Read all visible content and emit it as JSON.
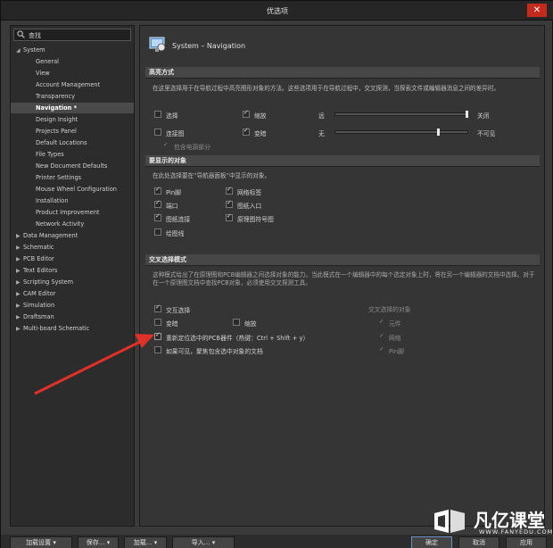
{
  "window": {
    "title": "优选项",
    "close": "✕"
  },
  "search": {
    "value": "查找"
  },
  "tree": [
    {
      "label": "System",
      "arrow": "◢",
      "depth": 0
    },
    {
      "label": "General",
      "arrow": "",
      "depth": 1
    },
    {
      "label": "View",
      "arrow": "",
      "depth": 1
    },
    {
      "label": "Account Management",
      "arrow": "",
      "depth": 1
    },
    {
      "label": "Transparency",
      "arrow": "",
      "depth": 1
    },
    {
      "label": "Navigation *",
      "arrow": "",
      "depth": 1,
      "selected": true
    },
    {
      "label": "Design Insight",
      "arrow": "",
      "depth": 1
    },
    {
      "label": "Projects Panel",
      "arrow": "",
      "depth": 1
    },
    {
      "label": "Default Locations",
      "arrow": "",
      "depth": 1
    },
    {
      "label": "File Types",
      "arrow": "",
      "depth": 1
    },
    {
      "label": "New Document Defaults",
      "arrow": "",
      "depth": 1
    },
    {
      "label": "Printer Settings",
      "arrow": "",
      "depth": 1
    },
    {
      "label": "Mouse Wheel Configuration",
      "arrow": "",
      "depth": 1
    },
    {
      "label": "Installation",
      "arrow": "",
      "depth": 1
    },
    {
      "label": "Product Improvement",
      "arrow": "",
      "depth": 1
    },
    {
      "label": "Network Activity",
      "arrow": "",
      "depth": 1
    },
    {
      "label": "Data Management",
      "arrow": "▶",
      "depth": 0
    },
    {
      "label": "Schematic",
      "arrow": "▶",
      "depth": 0
    },
    {
      "label": "PCB Editor",
      "arrow": "▶",
      "depth": 0
    },
    {
      "label": "Text Editors",
      "arrow": "▶",
      "depth": 0
    },
    {
      "label": "Scripting System",
      "arrow": "▶",
      "depth": 0
    },
    {
      "label": "CAM Editor",
      "arrow": "▶",
      "depth": 0
    },
    {
      "label": "Simulation",
      "arrow": "▶",
      "depth": 0
    },
    {
      "label": "Draftsman",
      "arrow": "▶",
      "depth": 0
    },
    {
      "label": "Multi-board Schematic",
      "arrow": "▶",
      "depth": 0
    }
  ],
  "page": {
    "title": "System – Navigation"
  },
  "highlight": {
    "header": "高亮方式",
    "desc": "在这里选择用于在导航过程中高亮图形对象的方法。这些选项用于在导航过程中，交叉探测，当探索文件或编辑器消息之间的差异时。",
    "select": "选择",
    "zoom": "缩放",
    "far": "远",
    "off": "关闭",
    "connect": "连接图",
    "dim": "变暗",
    "none": "无",
    "invisible": "不可见",
    "power": "包含电源部分",
    "slider1_level": 1.0,
    "slider2_level": 0.78
  },
  "display": {
    "header": "要显示的对象",
    "desc": "在此处选择要在“导航器面板”中显示的对象。",
    "pin": "Pin脚",
    "netlabel": "网络标签",
    "port": "端口",
    "sheetentry": "图纸入口",
    "sheetconn": "图纸连接",
    "sheetsym": "原理图符号图",
    "wire": "绘图线"
  },
  "cross": {
    "header": "交叉选择模式",
    "desc": "这种模式给出了在原理图和PCB编辑器之间选择对象的能力。当此模式在一个编辑器中的每个选定对象上时，将在另一个编辑器的文档中选择。对于在一个原理图文档中查找PCB对象，必须使用交叉探测工具。",
    "enable": "交互选择",
    "dim": "变暗",
    "zoom": "缩放",
    "reposition": "重新定位选中的PCB器件（热键：Ctrl + Shift + y）",
    "focus": "如果可见，聚焦包含选中对象的文档",
    "objects_header": "交叉选择的对象",
    "obj_part": "元件",
    "obj_net": "网络",
    "obj_pin": "Pin脚"
  },
  "buttons": {
    "save": "加载设置",
    "save2": "保存...",
    "load": "加载...",
    "import": "导入...",
    "ok": "确定",
    "cancel": "取消",
    "apply": "应用"
  },
  "watermark": {
    "brand": "凡亿课堂",
    "url": "WWW.FANYEDU.COM"
  }
}
